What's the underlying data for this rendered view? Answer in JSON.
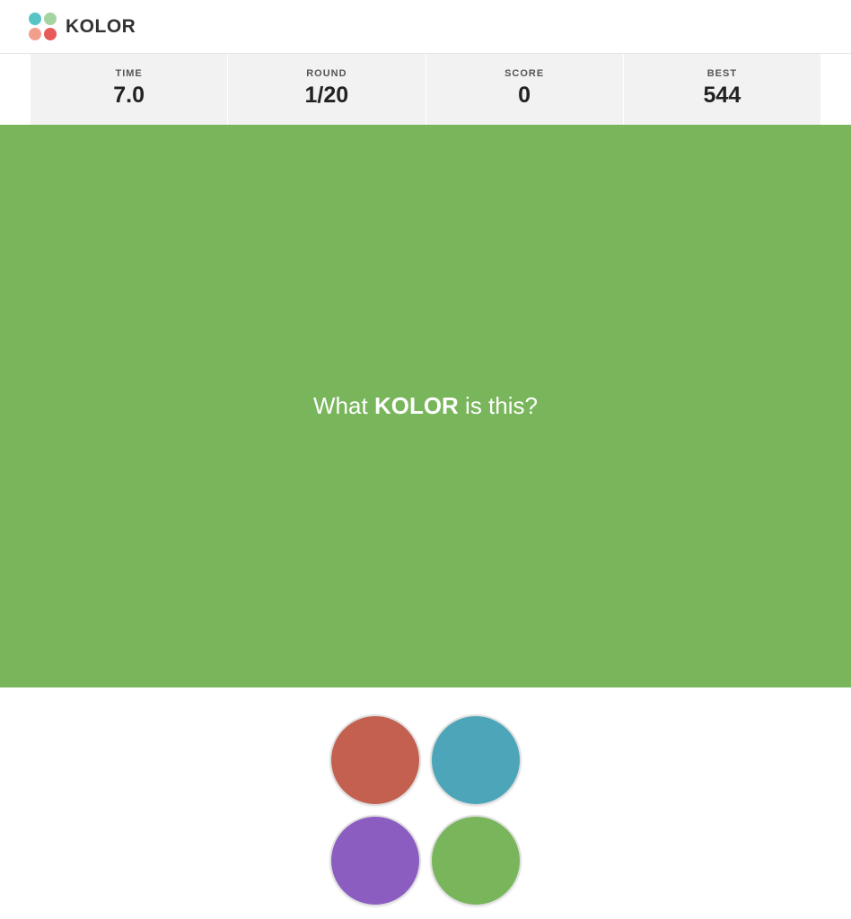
{
  "brand": {
    "name": "KOLOR",
    "dot_colors": [
      "#56c4c4",
      "#a4d4a2",
      "#f29e8c",
      "#e75a5a"
    ]
  },
  "stats": {
    "time_label": "TIME",
    "time_value": "7.0",
    "round_label": "ROUND",
    "round_value": "1/20",
    "score_label": "SCORE",
    "score_value": "0",
    "best_label": "BEST",
    "best_value": "544"
  },
  "game": {
    "target_color": "#78b55b",
    "question_pre": "What ",
    "question_bold": "KOLOR",
    "question_post": " is this?",
    "choices": [
      {
        "color": "#c3604f",
        "name": "choice-red"
      },
      {
        "color": "#4ca5b8",
        "name": "choice-teal"
      },
      {
        "color": "#8c5dc0",
        "name": "choice-purple"
      },
      {
        "color": "#78b55b",
        "name": "choice-green"
      }
    ]
  }
}
